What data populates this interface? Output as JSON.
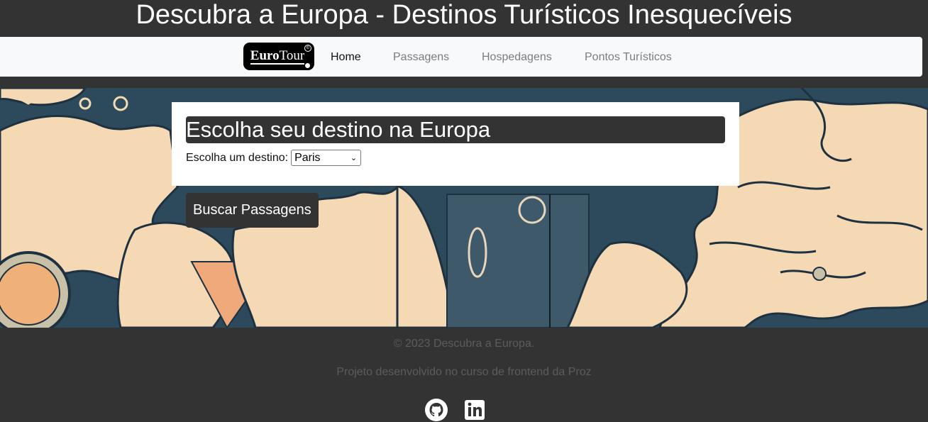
{
  "header": {
    "title": "Descubra a Europa - Destinos Turísticos Inesquecíveis"
  },
  "navbar": {
    "logo": {
      "text_bold": "Euro",
      "text_light": "Tour",
      "mark": "©"
    },
    "items": [
      {
        "label": "Home",
        "active": true
      },
      {
        "label": "Passagens",
        "active": false
      },
      {
        "label": "Hospedagens",
        "active": false
      },
      {
        "label": "Pontos Turísticos",
        "active": false
      }
    ]
  },
  "hero": {
    "background_icon": "vintage-europe-map-illustration",
    "card": {
      "title": "Escolha seu destino na Europa",
      "select_label": "Escolha um destino:",
      "select_value": "Paris"
    },
    "button_label": "Buscar Passagens"
  },
  "footer": {
    "copyright": "© 2023 Descubra a Europa.",
    "credit": "Projeto desenvolvido no curso de frontend da Proz",
    "social": [
      {
        "icon": "github-icon"
      },
      {
        "icon": "linkedin-icon"
      }
    ]
  },
  "colors": {
    "dark": "#333333",
    "navbar_bg": "#f8f9fa",
    "map_sea": "#2d4a5c",
    "map_land": "#f5d9b4",
    "footer_text": "#5c5c5c"
  }
}
